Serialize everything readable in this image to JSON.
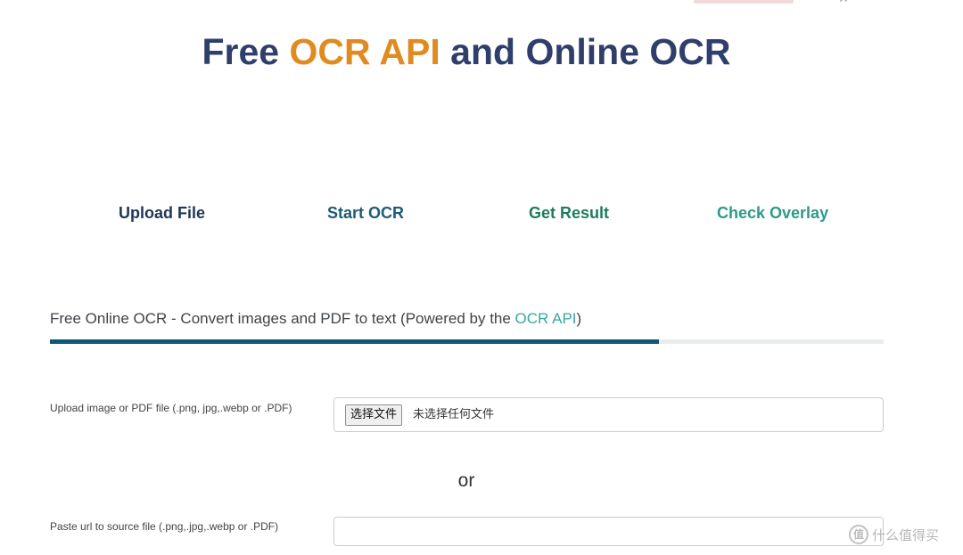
{
  "header": {
    "title_prefix": "Free ",
    "title_accent": "OCR API",
    "title_suffix": " and Online OCR",
    "close_glyph": "✕"
  },
  "steps": [
    {
      "label": "Upload File"
    },
    {
      "label": "Start OCR"
    },
    {
      "label": "Get Result"
    },
    {
      "label": "Check Overlay"
    }
  ],
  "section": {
    "title_prefix": "Free Online OCR - Convert images and PDF to text (Powered by the ",
    "title_link": "OCR API",
    "title_suffix": ")",
    "progress_percent": 73
  },
  "upload": {
    "label": "Upload image or PDF file (.png, jpg,.webp or .PDF)",
    "button_label": "选择文件",
    "status_text": "未选择任何文件"
  },
  "separator": "or",
  "url_input": {
    "label": "Paste url to source file (.png,.jpg,.webp or .PDF)",
    "value": "",
    "placeholder": ""
  },
  "watermark": {
    "logo_glyph": "值",
    "text": "什么值得买"
  },
  "colors": {
    "title": "#2f3e6b",
    "accent": "#e08b1f",
    "link": "#35a99a",
    "progress": "#0f5776"
  },
  "icons": {
    "close": "close-icon"
  }
}
